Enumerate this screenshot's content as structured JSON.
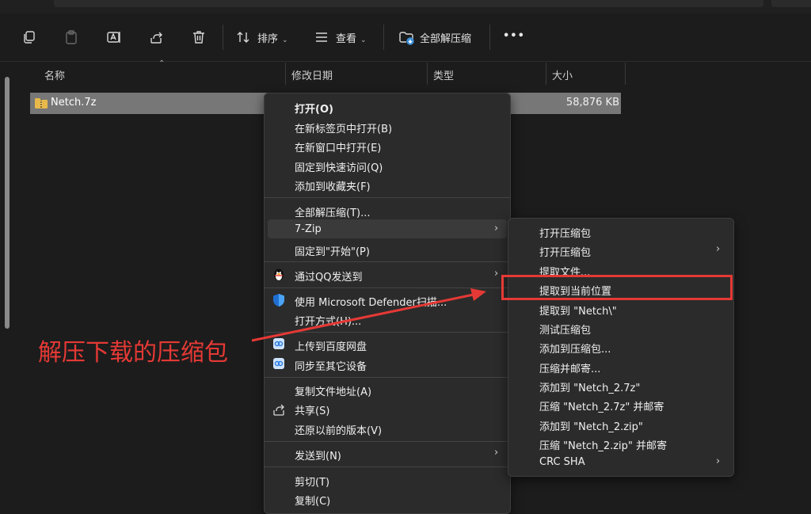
{
  "toolbar": {
    "sort_label": "排序",
    "view_label": "查看",
    "extract_all_label": "全部解压缩",
    "more_label": "•••"
  },
  "columns": {
    "name": "名称",
    "modified": "修改日期",
    "type": "类型",
    "size": "大小"
  },
  "file": {
    "name": "Netch.7z",
    "size": "58,876 KB"
  },
  "context_menu": {
    "open": "打开(O)",
    "open_new_tab": "在新标签页中打开(B)",
    "open_new_window": "在新窗口中打开(E)",
    "pin_quick_access": "固定到快速访问(Q)",
    "add_favorites": "添加到收藏夹(F)",
    "extract_all": "全部解压缩(T)...",
    "seven_zip": "7-Zip",
    "pin_start": "固定到\"开始\"(P)",
    "send_qq": "通过QQ发送到",
    "defender": "使用 Microsoft Defender扫描...",
    "open_with": "打开方式(H)...",
    "upload_baidu": "上传到百度网盘",
    "sync_devices": "同步至其它设备",
    "copy_path": "复制文件地址(A)",
    "share": "共享(S)",
    "restore_versions": "还原以前的版本(V)",
    "send_to": "发送到(N)",
    "cut": "剪切(T)",
    "copy": "复制(C)"
  },
  "submenu": {
    "items": [
      "打开压缩包",
      "打开压缩包",
      "提取文件...",
      "提取到当前位置",
      "提取到 \"Netch\\\"",
      "测试压缩包",
      "添加到压缩包...",
      "压缩并邮寄...",
      "添加到 \"Netch_2.7z\"",
      "压缩 \"Netch_2.7z\" 并邮寄",
      "添加到 \"Netch_2.zip\"",
      "压缩 \"Netch_2.zip\" 并邮寄",
      "CRC SHA"
    ]
  },
  "annotation": {
    "text": "解压下载的压缩包",
    "color": "#e53935"
  },
  "colors": {
    "background": "#1c1c1c",
    "menu": "#2b2b2b",
    "selected_row": "#777777"
  }
}
